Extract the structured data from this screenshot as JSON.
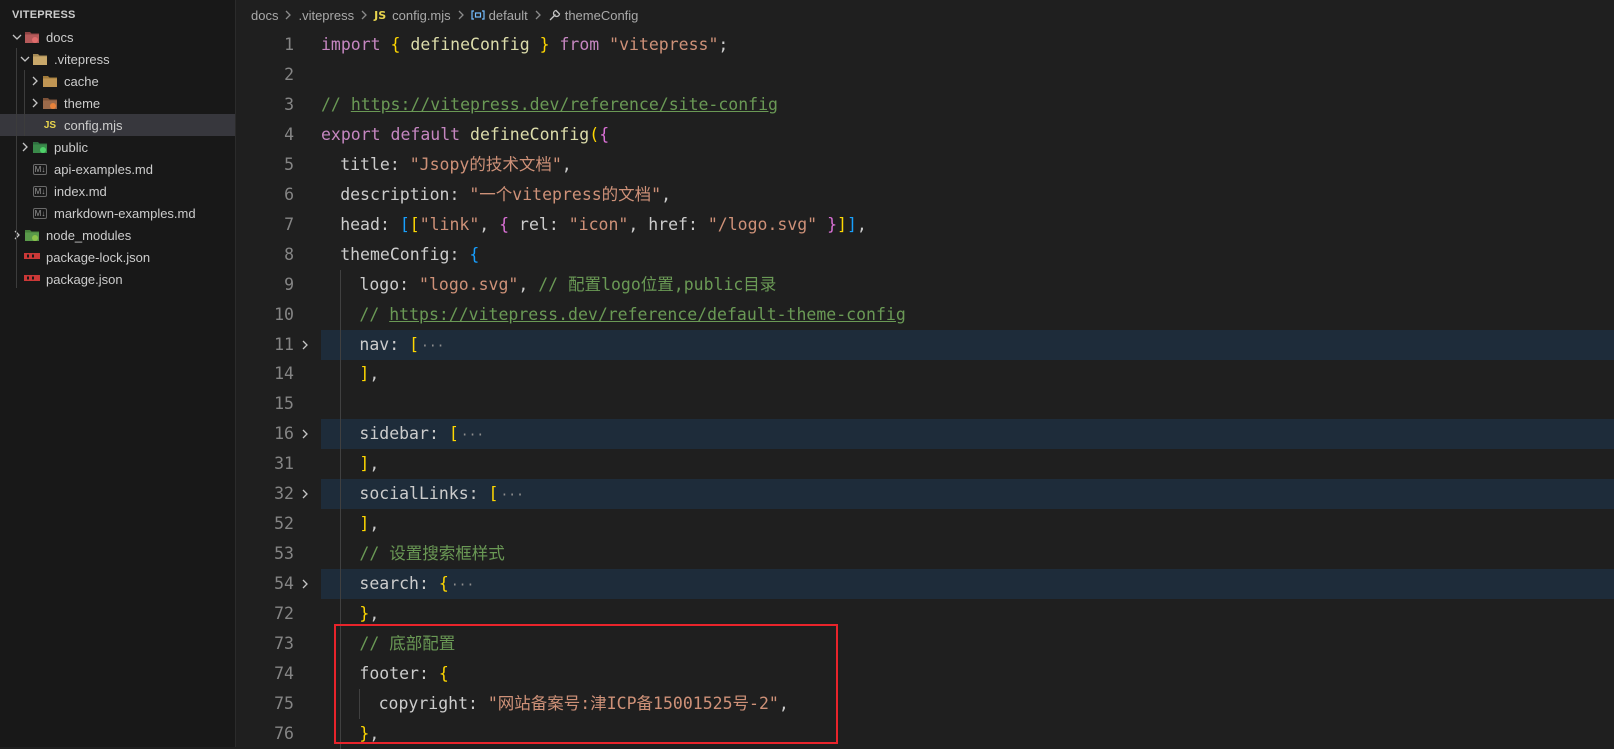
{
  "explorer": {
    "root": "VITEPRESS",
    "items": [
      {
        "label": "docs",
        "depth": 0,
        "kind": "folder-open",
        "icon": "docs-folder-icon"
      },
      {
        "label": ".vitepress",
        "depth": 1,
        "kind": "folder-open",
        "icon": "vitepress-folder-icon"
      },
      {
        "label": "cache",
        "depth": 2,
        "kind": "folder",
        "icon": "folder-icon"
      },
      {
        "label": "theme",
        "depth": 2,
        "kind": "folder",
        "icon": "theme-folder-icon"
      },
      {
        "label": "config.mjs",
        "depth": 2,
        "kind": "js",
        "icon": "js-file-icon",
        "selected": true
      },
      {
        "label": "public",
        "depth": 1,
        "kind": "folder",
        "icon": "public-folder-icon"
      },
      {
        "label": "api-examples.md",
        "depth": 1,
        "kind": "md",
        "icon": "markdown-file-icon"
      },
      {
        "label": "index.md",
        "depth": 1,
        "kind": "md",
        "icon": "markdown-file-icon"
      },
      {
        "label": "markdown-examples.md",
        "depth": 1,
        "kind": "md",
        "icon": "markdown-file-icon"
      },
      {
        "label": "node_modules",
        "depth": 0,
        "kind": "folder",
        "icon": "node-modules-folder-icon"
      },
      {
        "label": "package-lock.json",
        "depth": 0,
        "kind": "npm",
        "icon": "npm-file-icon"
      },
      {
        "label": "package.json",
        "depth": 0,
        "kind": "npm",
        "icon": "npm-file-icon"
      }
    ],
    "js_badge": "JS",
    "md_badge": "M↓"
  },
  "breadcrumb": {
    "items": [
      "docs",
      ".vitepress",
      "config.mjs",
      "default",
      "themeConfig"
    ],
    "js_badge": "JS"
  },
  "code": {
    "lines": [
      {
        "num": "1",
        "indent": 0,
        "folded": false,
        "tokens": [
          [
            "kw",
            "import"
          ],
          [
            "punc",
            " "
          ],
          [
            "br1",
            "{"
          ],
          [
            "punc",
            " "
          ],
          [
            "fn",
            "defineConfig"
          ],
          [
            "punc",
            " "
          ],
          [
            "br1",
            "}"
          ],
          [
            "punc",
            " "
          ],
          [
            "kw",
            "from"
          ],
          [
            "punc",
            " "
          ],
          [
            "str",
            "\"vitepress\""
          ],
          [
            "punc",
            ";"
          ]
        ]
      },
      {
        "num": "2",
        "indent": 0,
        "folded": false,
        "tokens": []
      },
      {
        "num": "3",
        "indent": 0,
        "folded": false,
        "tokens": [
          [
            "com",
            "// "
          ],
          [
            "link",
            "https://vitepress.dev/reference/site-config"
          ]
        ]
      },
      {
        "num": "4",
        "indent": 0,
        "folded": false,
        "tokens": [
          [
            "kw",
            "export"
          ],
          [
            "punc",
            " "
          ],
          [
            "kw",
            "default"
          ],
          [
            "punc",
            " "
          ],
          [
            "fn",
            "defineConfig"
          ],
          [
            "br1",
            "("
          ],
          [
            "br2",
            "{"
          ]
        ]
      },
      {
        "num": "5",
        "indent": 1,
        "folded": false,
        "tokens": [
          [
            "prop",
            "title"
          ],
          [
            "punc",
            ": "
          ],
          [
            "str",
            "\"Jsopy的技术文档\""
          ],
          [
            "punc",
            ","
          ]
        ]
      },
      {
        "num": "6",
        "indent": 1,
        "folded": false,
        "tokens": [
          [
            "prop",
            "description"
          ],
          [
            "punc",
            ": "
          ],
          [
            "str",
            "\"一个vitepress的文档\""
          ],
          [
            "punc",
            ","
          ]
        ]
      },
      {
        "num": "7",
        "indent": 1,
        "folded": false,
        "tokens": [
          [
            "prop",
            "head"
          ],
          [
            "punc",
            ": "
          ],
          [
            "br3",
            "["
          ],
          [
            "br1",
            "["
          ],
          [
            "str",
            "\"link\""
          ],
          [
            "punc",
            ", "
          ],
          [
            "br2",
            "{"
          ],
          [
            "punc",
            " "
          ],
          [
            "prop",
            "rel"
          ],
          [
            "punc",
            ": "
          ],
          [
            "str",
            "\"icon\""
          ],
          [
            "punc",
            ", "
          ],
          [
            "prop",
            "href"
          ],
          [
            "punc",
            ": "
          ],
          [
            "str",
            "\"/logo.svg\""
          ],
          [
            "punc",
            " "
          ],
          [
            "br2",
            "}"
          ],
          [
            "br1",
            "]"
          ],
          [
            "br3",
            "]"
          ],
          [
            "punc",
            ","
          ]
        ]
      },
      {
        "num": "8",
        "indent": 1,
        "folded": false,
        "tokens": [
          [
            "prop",
            "themeConfig"
          ],
          [
            "punc",
            ": "
          ],
          [
            "br3",
            "{"
          ]
        ]
      },
      {
        "num": "9",
        "indent": 2,
        "folded": false,
        "tokens": [
          [
            "prop",
            "logo"
          ],
          [
            "punc",
            ": "
          ],
          [
            "str",
            "\"logo.svg\""
          ],
          [
            "punc",
            ", "
          ],
          [
            "com",
            "// 配置logo位置,public目录"
          ]
        ]
      },
      {
        "num": "10",
        "indent": 2,
        "folded": false,
        "tokens": [
          [
            "com",
            "// "
          ],
          [
            "link",
            "https://vitepress.dev/reference/default-theme-config"
          ]
        ]
      },
      {
        "num": "11",
        "indent": 2,
        "folded": true,
        "tokens": [
          [
            "prop",
            "nav"
          ],
          [
            "punc",
            ": "
          ],
          [
            "br1",
            "["
          ]
        ]
      },
      {
        "num": "14",
        "indent": 2,
        "folded": false,
        "tokens": [
          [
            "br1",
            "]"
          ],
          [
            "punc",
            ","
          ]
        ]
      },
      {
        "num": "15",
        "indent": 2,
        "folded": false,
        "tokens": []
      },
      {
        "num": "16",
        "indent": 2,
        "folded": true,
        "tokens": [
          [
            "prop",
            "sidebar"
          ],
          [
            "punc",
            ": "
          ],
          [
            "br1",
            "["
          ]
        ]
      },
      {
        "num": "31",
        "indent": 2,
        "folded": false,
        "tokens": [
          [
            "br1",
            "]"
          ],
          [
            "punc",
            ","
          ]
        ]
      },
      {
        "num": "32",
        "indent": 2,
        "folded": true,
        "tokens": [
          [
            "prop",
            "socialLinks"
          ],
          [
            "punc",
            ": "
          ],
          [
            "br1",
            "["
          ]
        ]
      },
      {
        "num": "52",
        "indent": 2,
        "folded": false,
        "tokens": [
          [
            "br1",
            "]"
          ],
          [
            "punc",
            ","
          ]
        ]
      },
      {
        "num": "53",
        "indent": 2,
        "folded": false,
        "tokens": [
          [
            "com",
            "// 设置搜索框样式"
          ]
        ]
      },
      {
        "num": "54",
        "indent": 2,
        "folded": true,
        "tokens": [
          [
            "prop",
            "search"
          ],
          [
            "punc",
            ": "
          ],
          [
            "br1",
            "{"
          ]
        ]
      },
      {
        "num": "72",
        "indent": 2,
        "folded": false,
        "tokens": [
          [
            "br1",
            "}"
          ],
          [
            "punc",
            ","
          ]
        ]
      },
      {
        "num": "73",
        "indent": 2,
        "folded": false,
        "tokens": [
          [
            "com",
            "// 底部配置"
          ]
        ]
      },
      {
        "num": "74",
        "indent": 2,
        "folded": false,
        "tokens": [
          [
            "prop",
            "footer"
          ],
          [
            "punc",
            ": "
          ],
          [
            "br1",
            "{"
          ]
        ]
      },
      {
        "num": "75",
        "indent": 3,
        "folded": false,
        "tokens": [
          [
            "prop",
            "copyright"
          ],
          [
            "punc",
            ": "
          ],
          [
            "str",
            "\"网站备案号:津ICP备15001525号-2\""
          ],
          [
            "punc",
            ","
          ]
        ]
      },
      {
        "num": "76",
        "indent": 2,
        "folded": false,
        "tokens": [
          [
            "br1",
            "}"
          ],
          [
            "punc",
            ","
          ]
        ]
      }
    ],
    "ellipsis": "···"
  },
  "colors": {
    "highlight_box": "#e8242b",
    "folded_line_bg": "#1e2c3a",
    "selected_row_bg": "#37373d"
  }
}
